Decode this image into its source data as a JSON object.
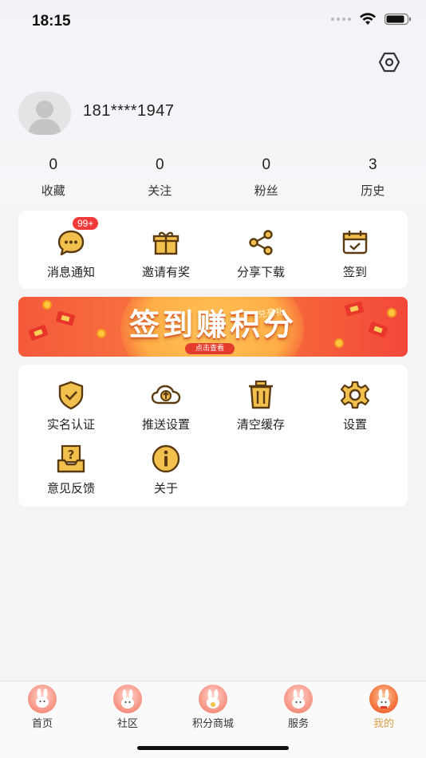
{
  "status_bar": {
    "time": "18:15"
  },
  "profile": {
    "phone": "181****1947"
  },
  "stats": [
    {
      "value": "0",
      "label": "收藏"
    },
    {
      "value": "0",
      "label": "关注"
    },
    {
      "value": "0",
      "label": "粉丝"
    },
    {
      "value": "3",
      "label": "历史"
    }
  ],
  "quick_actions": [
    {
      "label": "消息通知",
      "icon": "message-icon",
      "badge": "99+"
    },
    {
      "label": "邀请有奖",
      "icon": "gift-icon"
    },
    {
      "label": "分享下载",
      "icon": "share-icon"
    },
    {
      "label": "签到",
      "icon": "calendar-check-icon"
    }
  ],
  "banner": {
    "title": "签到赚积分",
    "tag": "兑豪礼",
    "button": "点击查看"
  },
  "tools": [
    {
      "label": "实名认证",
      "icon": "shield-check-icon"
    },
    {
      "label": "推送设置",
      "icon": "cloud-upload-icon"
    },
    {
      "label": "清空缓存",
      "icon": "trash-icon"
    },
    {
      "label": "设置",
      "icon": "gear-icon"
    },
    {
      "label": "意见反馈",
      "icon": "feedback-box-icon"
    },
    {
      "label": "关于",
      "icon": "info-icon"
    }
  ],
  "tabs": [
    {
      "label": "首页"
    },
    {
      "label": "社区"
    },
    {
      "label": "积分商城"
    },
    {
      "label": "服务"
    },
    {
      "label": "我的",
      "active": true
    }
  ],
  "colors": {
    "accent": "#d8a24a",
    "icon_dark": "#5a3a10",
    "icon_gold": "#f2c04d",
    "badge": "#f23a3a"
  }
}
